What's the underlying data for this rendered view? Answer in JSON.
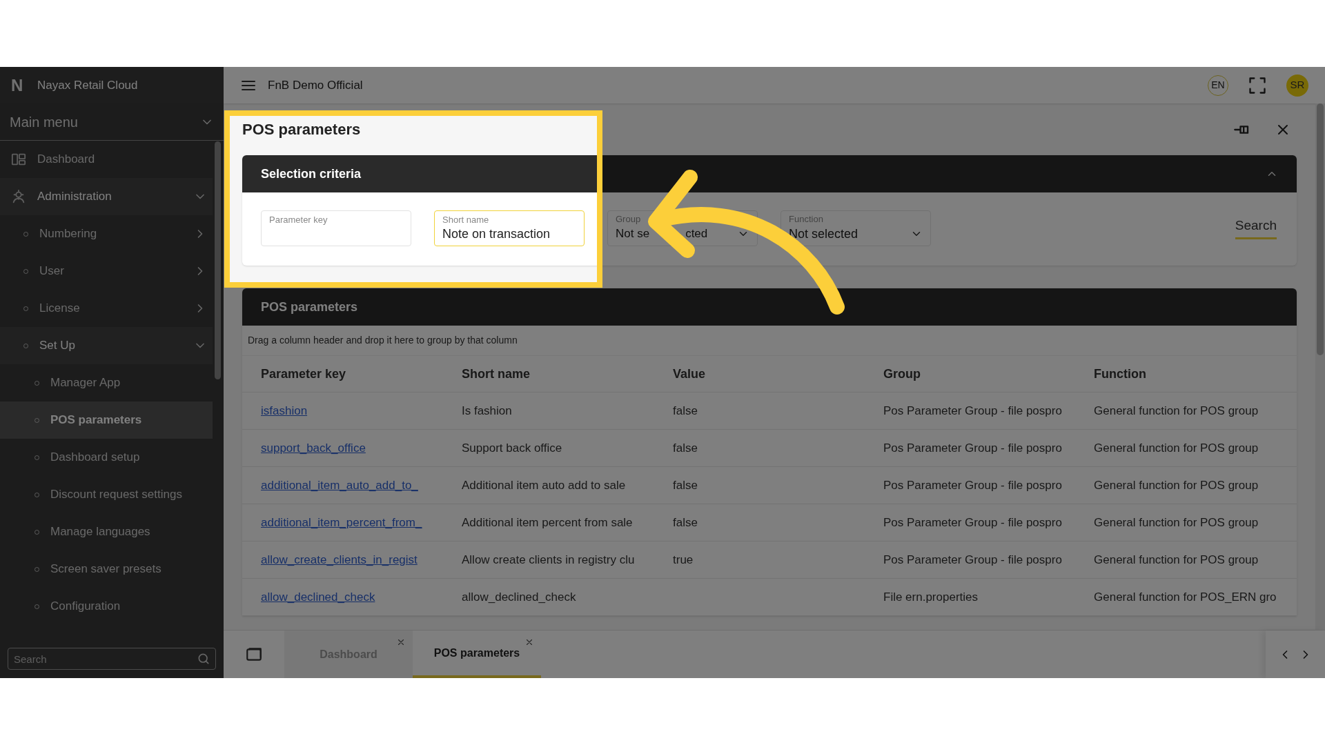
{
  "logo": "N",
  "sidebar": {
    "brand": "Nayax Retail Cloud",
    "menu_title": "Main menu",
    "menu_expanded": true,
    "items": [
      {
        "label": "Dashboard",
        "selected": false
      },
      {
        "label": "Administration",
        "selected": false,
        "expanded": true,
        "children": [
          {
            "label": "Numbering",
            "selected": false,
            "expanded": false
          },
          {
            "label": "User",
            "selected": false,
            "expanded": false
          },
          {
            "label": "License",
            "selected": false,
            "expanded": false
          },
          {
            "label": "Set Up",
            "selected": false,
            "expanded": true,
            "children": [
              {
                "label": "Manager App",
                "selected": false
              },
              {
                "label": "POS parameters",
                "selected": true
              },
              {
                "label": "Dashboard setup",
                "selected": false
              },
              {
                "label": "Discount request settings",
                "selected": false
              },
              {
                "label": "Manage languages",
                "selected": false
              },
              {
                "label": "Screen saver presets",
                "selected": false
              },
              {
                "label": "Configuration",
                "selected": false
              }
            ]
          }
        ]
      }
    ],
    "search": {
      "placeholder": "Search"
    }
  },
  "header": {
    "title": "FnB Demo Official",
    "language": "EN",
    "user_initials": "SR"
  },
  "page": {
    "title": "POS parameters"
  },
  "selection_criteria": {
    "title": "Selection criteria",
    "expanded": true,
    "fields": [
      {
        "kind": "text",
        "label": "Parameter key",
        "focused": false
      },
      {
        "kind": "text",
        "label": "Short name",
        "value": "Note on transaction",
        "focused": true
      },
      {
        "kind": "select",
        "label": "Group",
        "value_start": "Not se",
        "value_end": "cted",
        "focused": false
      },
      {
        "kind": "select",
        "label": "Function",
        "value": "Not selected",
        "focused": false
      }
    ],
    "search_button": "Search"
  },
  "table": {
    "title": "POS parameters",
    "group_hint": "Drag a column header and drop it here to group by that column",
    "columns": [
      "Parameter key",
      "Short name",
      "Value",
      "Group",
      "Function"
    ],
    "rows": [
      {
        "parameter_key": "isfashion",
        "short_name": "Is fashion",
        "value": "false",
        "group": "Pos Parameter Group - file pospro",
        "function": "General function for POS group"
      },
      {
        "parameter_key": "support_back_office",
        "short_name": "Support back office",
        "value": "false",
        "group": "Pos Parameter Group - file pospro",
        "function": "General function for POS group"
      },
      {
        "parameter_key": "additional_item_auto_add_to_",
        "short_name": "Additional item auto add to sale",
        "value": "false",
        "group": "Pos Parameter Group - file pospro",
        "function": "General function for POS group"
      },
      {
        "parameter_key": "additional_item_percent_from_",
        "short_name": "Additional item percent from sale",
        "value": "false",
        "group": "Pos Parameter Group - file pospro",
        "function": "General function for POS group"
      },
      {
        "parameter_key": "allow_create_clients_in_regist",
        "short_name": "Allow create clients in registry clu",
        "value": "true",
        "group": "Pos Parameter Group - file pospro",
        "function": "General function for POS group"
      },
      {
        "parameter_key": "allow_declined_check",
        "short_name": "allow_declined_check",
        "group": "File ern.properties",
        "function": "General function for POS_ERN gro"
      }
    ]
  },
  "tabs": [
    {
      "label": "Dashboard",
      "selected": false
    },
    {
      "label": "POS parameters",
      "selected": true
    }
  ]
}
